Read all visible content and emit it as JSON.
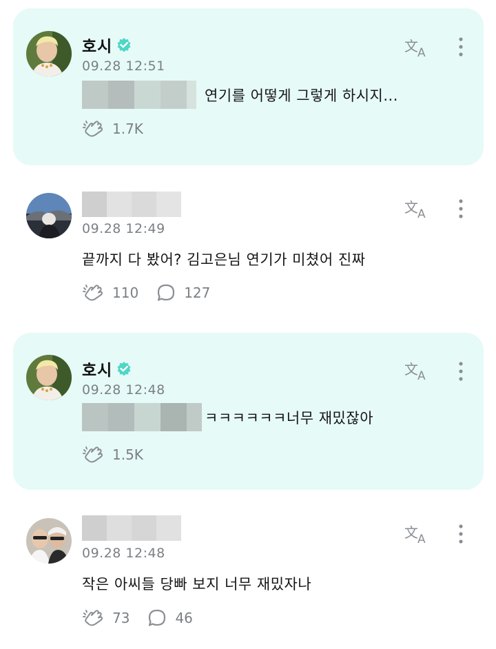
{
  "comments": [
    {
      "type": "artist",
      "author": "호시",
      "verified": true,
      "timestamp": "09.28 12:51",
      "text": "연기를 어떻게 그렇게 하시지...",
      "likes": "1.7K"
    },
    {
      "type": "fan",
      "timestamp": "09.28 12:49",
      "text": "끝까지 다 봤어? 김고은님 연기가 미쳤어 진짜",
      "likes": "110",
      "replies": "127"
    },
    {
      "type": "artist",
      "author": "호시",
      "verified": true,
      "timestamp": "09.28 12:48",
      "text": "ㅋㅋㅋㅋㅋㅋ너무 재밌잖아",
      "likes": "1.5K"
    },
    {
      "type": "fan",
      "timestamp": "09.28 12:48",
      "text": "작은 아씨들 당빠 보지 너무 재밌자나",
      "likes": "73",
      "replies": "46"
    }
  ],
  "colors": {
    "artist_card_bg": "#e6faf7",
    "verified": "#4fd6c6",
    "muted": "#7b7f84"
  },
  "icons": {
    "translate": "translate-icon",
    "more": "more-vertical-icon",
    "like": "clap-like-icon",
    "reply": "reply-bubble-icon",
    "verified": "verified-badge-icon"
  }
}
